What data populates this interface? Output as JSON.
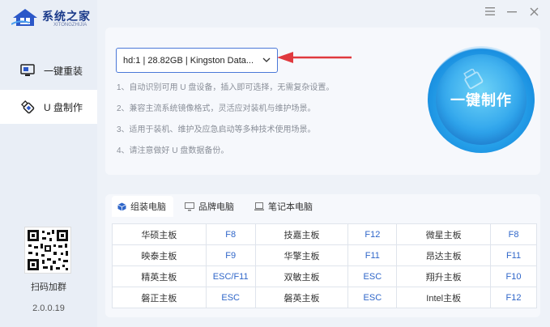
{
  "app": {
    "name": "系统之家",
    "sub": "XITONGZHIJIA",
    "version": "2.0.0.19"
  },
  "sidebar": {
    "items": [
      {
        "label": "一键重装",
        "icon": "monitor-icon",
        "active": false
      },
      {
        "label": "U 盘制作",
        "icon": "usb-icon",
        "active": true
      }
    ],
    "qr_label": "扫码加群"
  },
  "window_controls": [
    "menu-icon",
    "minimize-icon",
    "close-icon"
  ],
  "device_select": {
    "value": "hd:1 | 28.82GB | Kingston Data..."
  },
  "tips": [
    "1、自动识别可用 U 盘设备，插入即可选择，无需复杂设置。",
    "2、兼容主流系统镜像格式，灵活应对装机与维护场景。",
    "3、适用于装机、维护及应急启动等多种技术使用场景。",
    "4、请注意做好 U 盘数据备份。"
  ],
  "make_button": {
    "label": "一键制作"
  },
  "tabs": [
    {
      "label": "组装电脑",
      "icon": "cube-icon",
      "active": true
    },
    {
      "label": "品牌电脑",
      "icon": "desktop-icon",
      "active": false
    },
    {
      "label": "笔记本电脑",
      "icon": "laptop-icon",
      "active": false
    }
  ],
  "boot_keys": [
    [
      {
        "brand": "华硕主板",
        "key": "F8"
      },
      {
        "brand": "技嘉主板",
        "key": "F12"
      },
      {
        "brand": "微星主板",
        "key": "F8"
      }
    ],
    [
      {
        "brand": "映泰主板",
        "key": "F9"
      },
      {
        "brand": "华擎主板",
        "key": "F11"
      },
      {
        "brand": "昂达主板",
        "key": "F11"
      }
    ],
    [
      {
        "brand": "精英主板",
        "key": "ESC/F11"
      },
      {
        "brand": "双敏主板",
        "key": "ESC"
      },
      {
        "brand": "翔升主板",
        "key": "F10"
      }
    ],
    [
      {
        "brand": "磐正主板",
        "key": "ESC"
      },
      {
        "brand": "磐英主板",
        "key": "ESC"
      },
      {
        "brand": "Intel主板",
        "key": "F12"
      }
    ]
  ],
  "colors": {
    "accent": "#2f66c9",
    "arrow": "#e0393e",
    "button": "#2aa6ec"
  }
}
